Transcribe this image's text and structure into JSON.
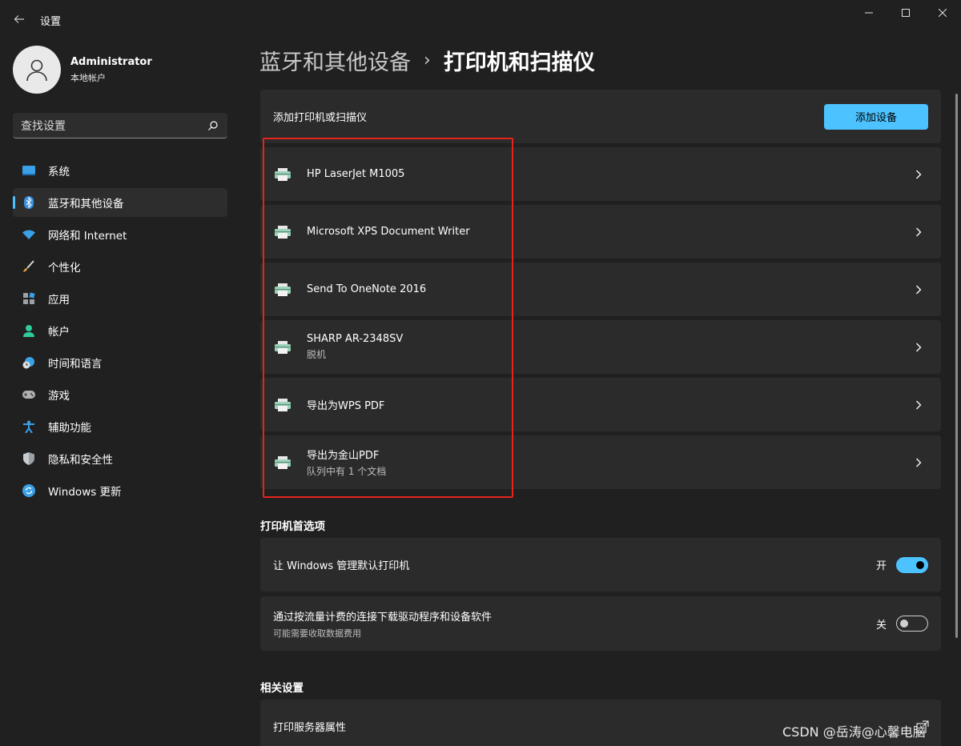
{
  "window": {
    "title": "设置",
    "back_icon": "back-arrow-icon"
  },
  "profile": {
    "name": "Administrator",
    "account_type": "本地帐户"
  },
  "search": {
    "placeholder": "查找设置"
  },
  "nav": {
    "items": [
      {
        "label": "系统",
        "icon": "system-icon"
      },
      {
        "label": "蓝牙和其他设备",
        "icon": "bluetooth-icon",
        "active": true
      },
      {
        "label": "网络和 Internet",
        "icon": "wifi-icon"
      },
      {
        "label": "个性化",
        "icon": "brush-icon"
      },
      {
        "label": "应用",
        "icon": "apps-icon"
      },
      {
        "label": "帐户",
        "icon": "account-icon"
      },
      {
        "label": "时间和语言",
        "icon": "globe-clock-icon"
      },
      {
        "label": "游戏",
        "icon": "gamepad-icon"
      },
      {
        "label": "辅助功能",
        "icon": "accessibility-icon"
      },
      {
        "label": "隐私和安全性",
        "icon": "shield-icon"
      },
      {
        "label": "Windows 更新",
        "icon": "update-icon"
      }
    ]
  },
  "breadcrumb": {
    "parent": "蓝牙和其他设备",
    "separator": "›",
    "current": "打印机和扫描仪"
  },
  "add_device": {
    "label": "添加打印机或扫描仪",
    "button": "添加设备"
  },
  "printers": [
    {
      "name": "HP LaserJet M1005",
      "status": ""
    },
    {
      "name": "Microsoft XPS Document Writer",
      "status": ""
    },
    {
      "name": "Send To OneNote 2016",
      "status": ""
    },
    {
      "name": "SHARP AR-2348SV",
      "status": "脱机"
    },
    {
      "name": "导出为WPS PDF",
      "status": ""
    },
    {
      "name": "导出为金山PDF",
      "status": "队列中有 1 个文档"
    }
  ],
  "preferences": {
    "title": "打印机首选项",
    "items": [
      {
        "title": "让 Windows 管理默认打印机",
        "subtitle": "",
        "state_label": "开",
        "on": true
      },
      {
        "title": "通过按流量计费的连接下载驱动程序和设备软件",
        "subtitle": "可能需要收取数据费用",
        "state_label": "关",
        "on": false
      }
    ]
  },
  "related": {
    "title": "相关设置",
    "items": [
      {
        "title": "打印服务器属性"
      }
    ]
  },
  "watermark": "CSDN @岳涛@心馨电脑",
  "colors": {
    "accent": "#4cc2ff",
    "background": "#202020",
    "card": "#2b2b2b",
    "highlight": "#e6241b"
  }
}
